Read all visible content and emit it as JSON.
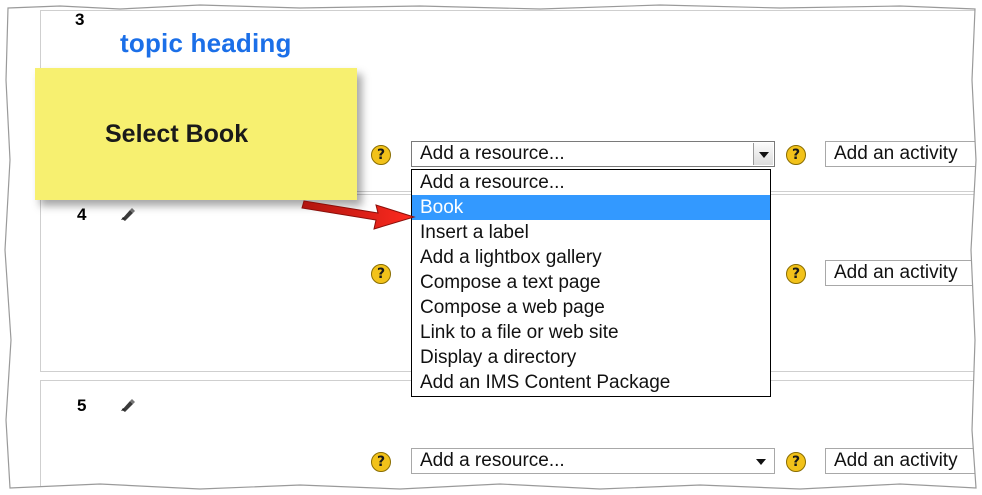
{
  "sections": [
    {
      "number": "3",
      "heading": "topic heading"
    },
    {
      "number": "4"
    },
    {
      "number": "5"
    }
  ],
  "controls": {
    "resource_label": "Add a resource...",
    "activity_label": "Add an activity",
    "help_glyph": "?"
  },
  "dropdown": {
    "items": [
      "Add a resource...",
      "Book",
      "Insert a label",
      "Add a lightbox gallery",
      "Compose a text page",
      "Compose a web page",
      "Link to a file or web site",
      "Display a directory",
      "Add an IMS Content Package"
    ],
    "selected": "Book"
  },
  "callout": {
    "text": "Select Book"
  },
  "icons": {
    "help": "help-icon",
    "edit": "edit-icon",
    "arrow": "arrow-icon"
  },
  "colors": {
    "heading": "#1b6fe8",
    "highlight": "#3399ff",
    "callout": "#f7f070",
    "arrow": "#e0241b",
    "help": "#f2c21a"
  }
}
